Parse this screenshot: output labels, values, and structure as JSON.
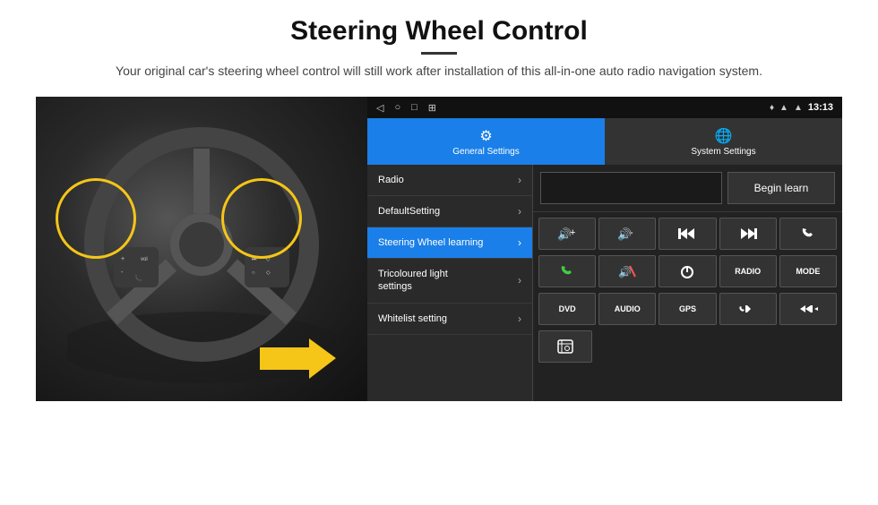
{
  "header": {
    "title": "Steering Wheel Control",
    "subtitle": "Your original car's steering wheel control will still work after installation of this all-in-one auto radio navigation system."
  },
  "status_bar": {
    "back_icon": "◁",
    "home_icon": "○",
    "square_icon": "□",
    "menu_icon": "⊞",
    "location_icon": "♦",
    "signal_icon": "▲",
    "wifi_icon": "▲",
    "time": "13:13"
  },
  "tabs": [
    {
      "label": "General Settings",
      "active": true
    },
    {
      "label": "System Settings",
      "active": false
    }
  ],
  "menu_items": [
    {
      "label": "Radio",
      "active": false
    },
    {
      "label": "DefaultSetting",
      "active": false
    },
    {
      "label": "Steering Wheel learning",
      "active": true
    },
    {
      "label": "Tricoloured light settings",
      "active": false
    },
    {
      "label": "Whitelist setting",
      "active": false
    }
  ],
  "controls": {
    "begin_learn": "Begin learn",
    "buttons_row1": [
      "🔊+",
      "🔊-",
      "⏮",
      "⏭",
      "📞"
    ],
    "buttons_row2": [
      "📞",
      "🔇",
      "⏻",
      "RADIO",
      "MODE"
    ],
    "buttons_row3": [
      "DVD",
      "AUDIO",
      "GPS",
      "📞⏮",
      "⏪⏭"
    ],
    "bottom_icon": "🗎"
  }
}
